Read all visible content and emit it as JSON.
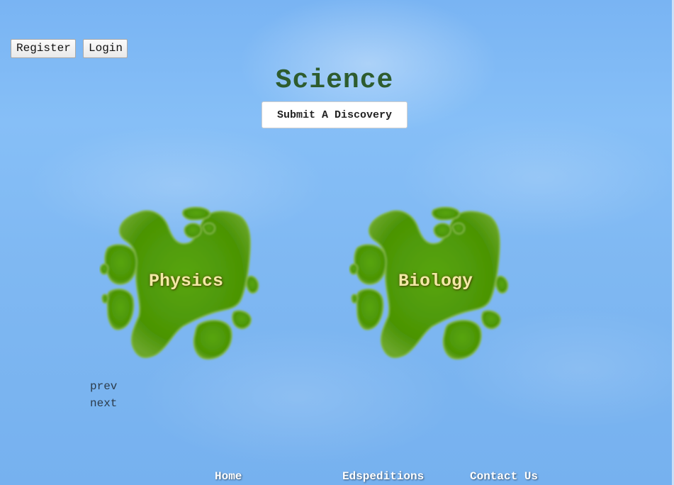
{
  "header": {
    "register_label": "Register",
    "login_label": "Login"
  },
  "main": {
    "title": "Science",
    "submit_label": "Submit A Discovery",
    "islands": [
      {
        "label": "Physics"
      },
      {
        "label": "Biology"
      }
    ],
    "pager": {
      "prev_label": "prev",
      "next_label": "next"
    }
  },
  "footer": {
    "links": [
      {
        "label": "Home"
      },
      {
        "label": "Edspeditions"
      },
      {
        "label": "Contact Us"
      }
    ]
  },
  "colors": {
    "sky": "#7fb8f2",
    "island_green": "#4e9a06",
    "title_green": "#2e5c2e",
    "label_yellow": "#f2e9a6"
  },
  "icons": {
    "island": "island-icon"
  }
}
